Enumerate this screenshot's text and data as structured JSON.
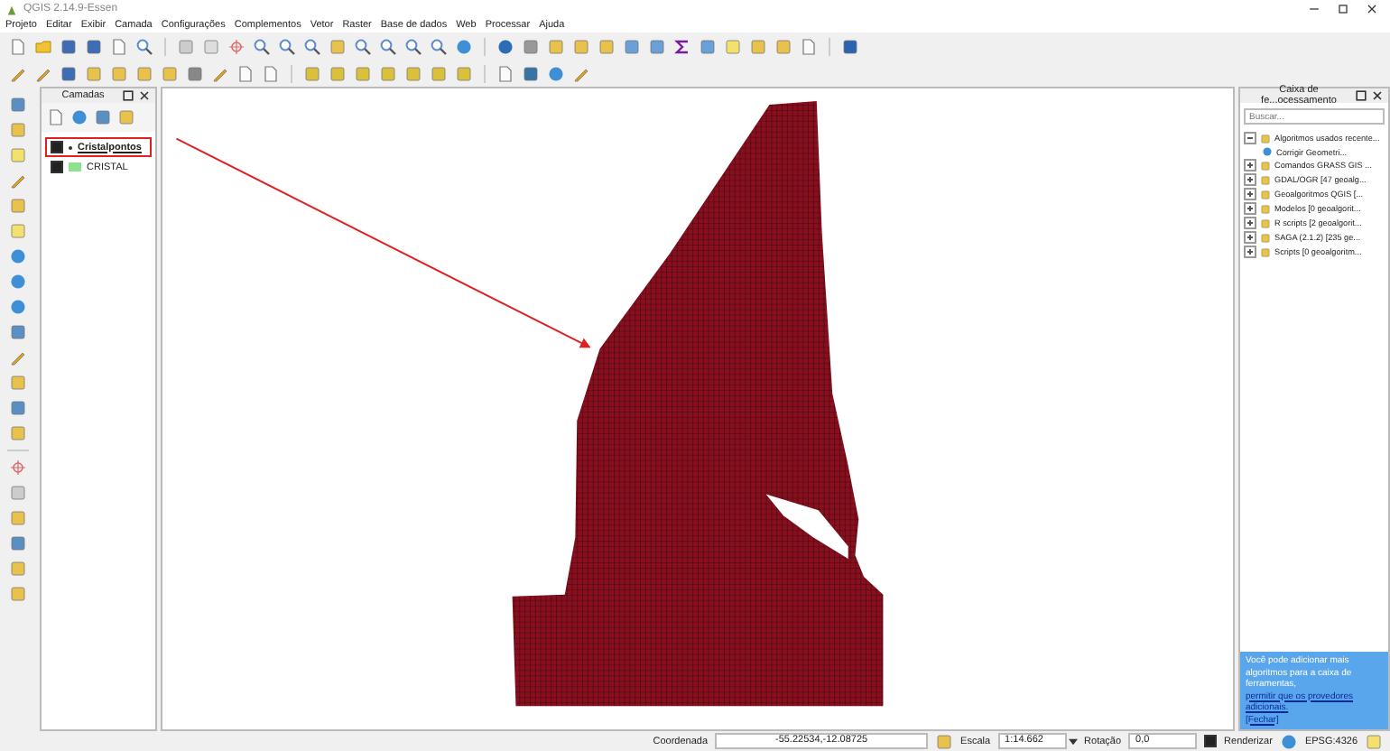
{
  "window": {
    "title": "QGIS 2.14.9-Essen"
  },
  "menu": [
    "Projeto",
    "Editar",
    "Exibir",
    "Camada",
    "Configurações",
    "Complementos",
    "Vetor",
    "Raster",
    "Base de dados",
    "Web",
    "Processar",
    "Ajuda"
  ],
  "layers_panel": {
    "title": "Camadas",
    "layers": [
      {
        "name": "Cristalpontos",
        "kind": "point",
        "checked": true,
        "selected": true,
        "highlighted": true
      },
      {
        "name": "CRISTAL",
        "kind": "polygon",
        "checked": true,
        "selected": false,
        "highlighted": false,
        "color": "#8fe08f"
      }
    ]
  },
  "toolbox": {
    "title": "Caixa de fe...ocessamento",
    "search": {
      "placeholder": "Buscar..."
    },
    "tree": [
      {
        "label": "Algoritmos usados recente...",
        "expanded": true,
        "children": [
          {
            "label": "Corrigir Geometri..."
          }
        ]
      },
      {
        "label": "Comandos GRASS GIS ...",
        "expanded": false
      },
      {
        "label": "GDAL/OGR [47 geoalg...",
        "expanded": false
      },
      {
        "label": "Geoalgoritmos QGIS [...",
        "expanded": false
      },
      {
        "label": "Modelos [0 geoalgorit...",
        "expanded": false
      },
      {
        "label": "R scripts [2 geoalgorit...",
        "expanded": false
      },
      {
        "label": "SAGA (2.1.2) [235 ge...",
        "expanded": false
      },
      {
        "label": "Scripts [0 geoalgoritm...",
        "expanded": false
      }
    ],
    "hint": {
      "text": "Você pode adicionar mais algoritmos para a caixa de ferramentas,",
      "link": "permitir que os provedores adicionais.",
      "close": "[Fechar]"
    }
  },
  "status_bar": {
    "coordinate_label": "Coordenada",
    "coordinate": "-55.22534,-12.08725",
    "scale_label": "Escala",
    "scale": "1:14.662",
    "rotation_label": "Rotação",
    "rotation": "0,0",
    "render": {
      "label": "Renderizar",
      "checked": true
    },
    "crs": "EPSG:4326"
  }
}
